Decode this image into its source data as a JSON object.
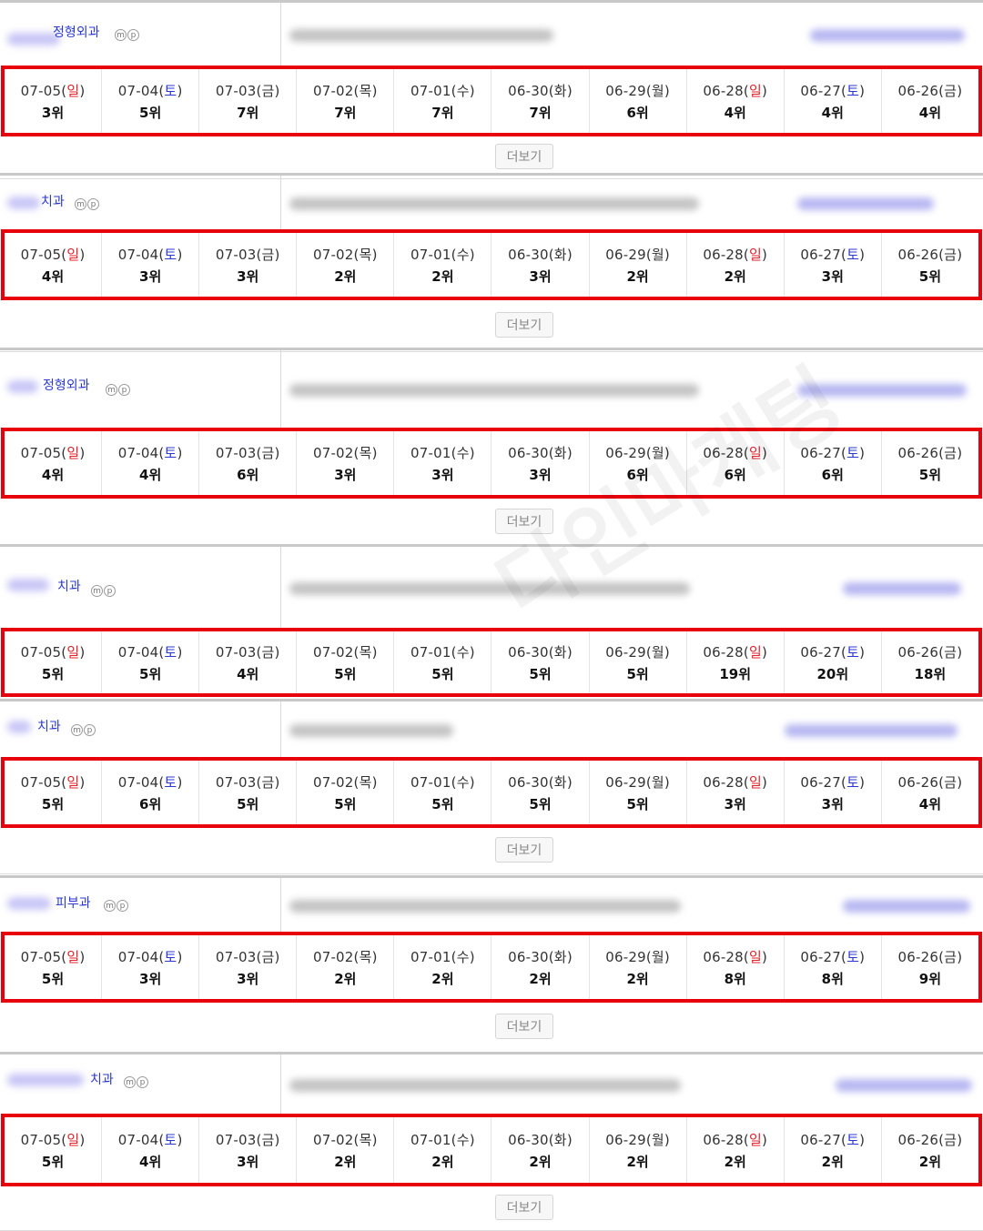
{
  "dates": [
    {
      "md": "07-05",
      "day": "일",
      "type": "sun"
    },
    {
      "md": "07-04",
      "day": "토",
      "type": "sat"
    },
    {
      "md": "07-03",
      "day": "금",
      "type": "wk"
    },
    {
      "md": "07-02",
      "day": "목",
      "type": "wk"
    },
    {
      "md": "07-01",
      "day": "수",
      "type": "wk"
    },
    {
      "md": "06-30",
      "day": "화",
      "type": "wk"
    },
    {
      "md": "06-29",
      "day": "월",
      "type": "wk"
    },
    {
      "md": "06-28",
      "day": "일",
      "type": "sun"
    },
    {
      "md": "06-27",
      "day": "토",
      "type": "sat"
    },
    {
      "md": "06-26",
      "day": "금",
      "type": "wk"
    }
  ],
  "mp_labels": [
    "m",
    "p"
  ],
  "more_label": "더보기",
  "watermark": "다인마케팅",
  "colors": {
    "highlight_border": "#e8000d",
    "sunday": "#e4202a",
    "saturday": "#2b39d1",
    "category": "#2b39d1"
  },
  "blocks": [
    {
      "category": "정형외과",
      "ranks": [
        "3위",
        "5위",
        "7위",
        "7위",
        "7위",
        "7위",
        "6위",
        "4위",
        "4위",
        "4위"
      ],
      "has_more": true
    },
    {
      "category": "치과",
      "ranks": [
        "4위",
        "3위",
        "3위",
        "2위",
        "2위",
        "3위",
        "2위",
        "2위",
        "3위",
        "5위"
      ],
      "has_more": true
    },
    {
      "category": "정형외과",
      "ranks": [
        "4위",
        "4위",
        "6위",
        "3위",
        "3위",
        "3위",
        "6위",
        "6위",
        "6위",
        "5위"
      ],
      "has_more": true
    },
    {
      "category": "치과",
      "ranks": [
        "5위",
        "5위",
        "4위",
        "5위",
        "5위",
        "5위",
        "5위",
        "19위",
        "20위",
        "18위"
      ],
      "has_more": false
    },
    {
      "category": "치과",
      "ranks": [
        "5위",
        "6위",
        "5위",
        "5위",
        "5위",
        "5위",
        "5위",
        "3위",
        "3위",
        "4위"
      ],
      "has_more": true
    },
    {
      "category": "피부과",
      "ranks": [
        "5위",
        "3위",
        "3위",
        "2위",
        "2위",
        "2위",
        "2위",
        "8위",
        "8위",
        "9위"
      ],
      "has_more": true
    },
    {
      "category": "치과",
      "ranks": [
        "5위",
        "4위",
        "3위",
        "2위",
        "2위",
        "2위",
        "2위",
        "2위",
        "2위",
        "2위"
      ],
      "has_more": true
    }
  ]
}
